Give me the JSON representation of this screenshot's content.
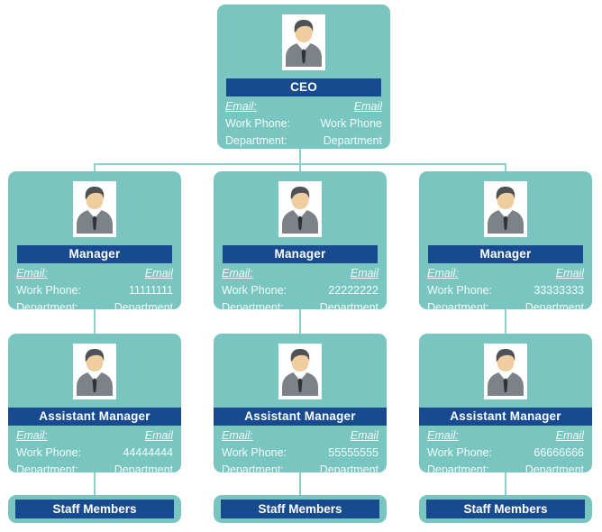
{
  "chart": {
    "type": "org-chart",
    "labels": {
      "email": "Email:",
      "work_phone": "Work Phone:",
      "department": "Department:"
    },
    "avatar_icon": "businessman-avatar-icon"
  },
  "ceo": {
    "title": "CEO",
    "email": "Email",
    "work_phone": "Work Phone",
    "department": "Department"
  },
  "managers": [
    {
      "title": "Manager",
      "email": "Email",
      "work_phone": "11111111",
      "department": "Department"
    },
    {
      "title": "Manager",
      "email": "Email",
      "work_phone": "22222222",
      "department": "Department"
    },
    {
      "title": "Manager",
      "email": "Email",
      "work_phone": "33333333",
      "department": "Department"
    }
  ],
  "assistant_managers": [
    {
      "title": "Assistant Manager",
      "email": "Email",
      "work_phone": "44444444",
      "department": "Department"
    },
    {
      "title": "Assistant Manager",
      "email": "Email",
      "work_phone": "55555555",
      "department": "Department"
    },
    {
      "title": "Assistant Manager",
      "email": "Email",
      "work_phone": "66666666",
      "department": "Department"
    }
  ],
  "staff": [
    {
      "title": "Staff Members"
    },
    {
      "title": "Staff Members"
    },
    {
      "title": "Staff Members"
    }
  ],
  "colors": {
    "card": "#79c6c0",
    "title_bar": "#174a8e",
    "connector": "#8fcfca",
    "text": "#f2fbfa",
    "background": "#ffffff"
  }
}
